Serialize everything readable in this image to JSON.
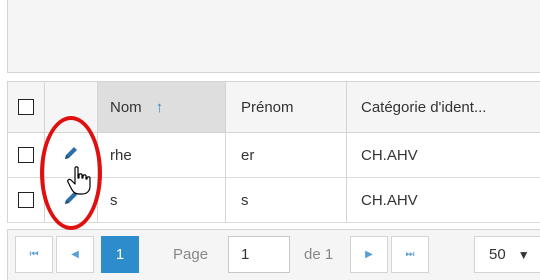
{
  "grid": {
    "columns": [
      {
        "label": ""
      },
      {
        "label": ""
      },
      {
        "label": "Nom"
      },
      {
        "label": "Prénom"
      },
      {
        "label": "Catégorie d'ident..."
      }
    ],
    "sort_icon": "↑",
    "rows": [
      {
        "nom": "rhe",
        "prenom": "er",
        "categorie": "CH.AHV"
      },
      {
        "nom": "s",
        "prenom": "s",
        "categorie": "CH.AHV"
      }
    ]
  },
  "pager": {
    "first": "⏮",
    "prev": "◀",
    "current_page": "1",
    "page_label": "Page",
    "page_input": "1",
    "of_label": "de 1",
    "next": "▶",
    "last": "⏭",
    "page_size": "50",
    "page_size_arrow": "▼"
  },
  "icons": {
    "edit": "pencil-icon",
    "cursor": "hand-pointer-icon"
  },
  "colors": {
    "accent": "#2d8ccb",
    "annotation": "#e01010"
  }
}
